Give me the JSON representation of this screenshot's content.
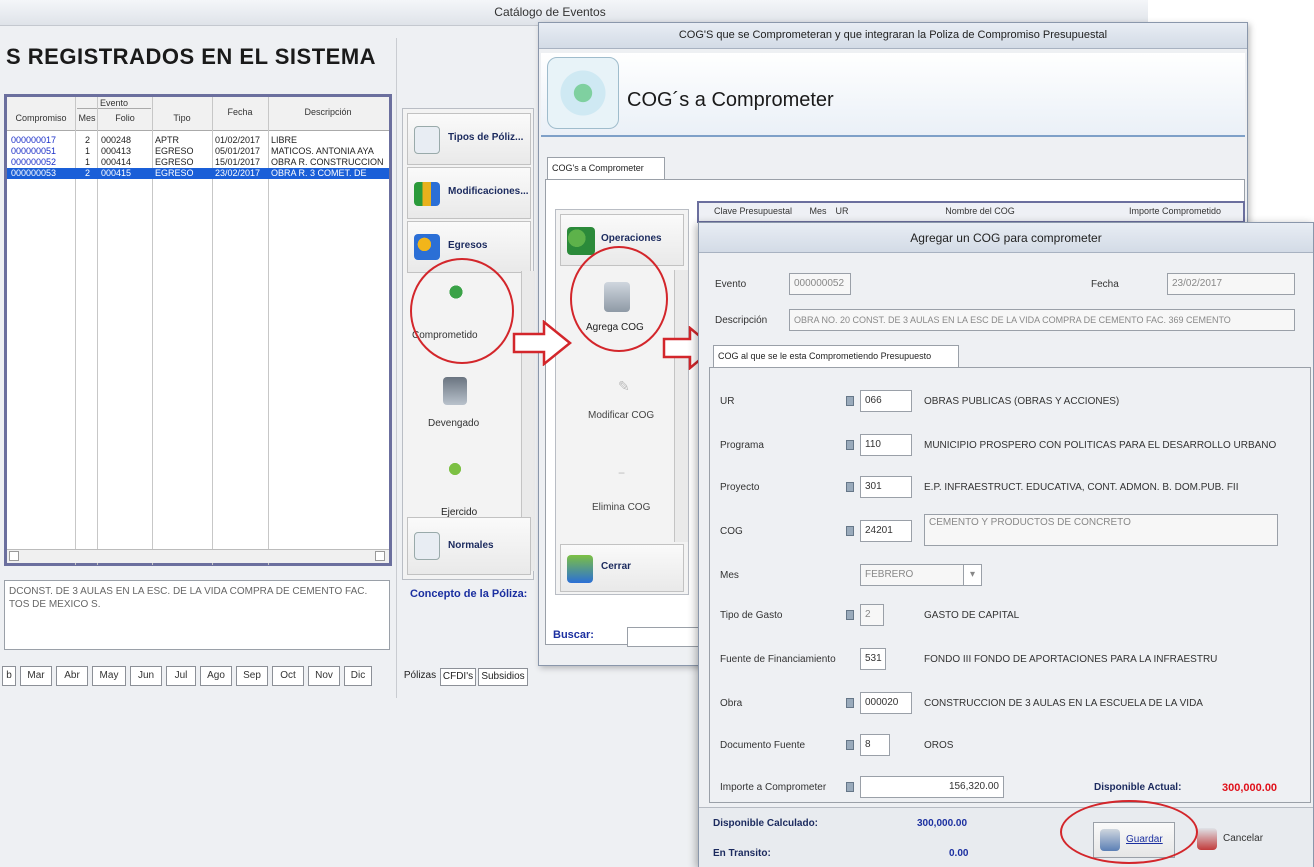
{
  "base_window": {
    "title": "Catálogo de Eventos",
    "heading": "S REGISTRADOS EN EL SISTEMA",
    "grid": {
      "group_header": "Evento",
      "headers": [
        "Compromiso",
        "Mes",
        "Folio",
        "Tipo",
        "Fecha",
        "Descripción"
      ],
      "rows": [
        {
          "compromiso": "000000017",
          "mes": "2",
          "folio": "000248",
          "tipo": "APTR",
          "fecha": "01/02/2017",
          "descripcion": "LIBRE"
        },
        {
          "compromiso": "000000051",
          "mes": "1",
          "folio": "000413",
          "tipo": "EGRESO",
          "fecha": "05/01/2017",
          "descripcion": "MATICOS. ANTONIA AYA"
        },
        {
          "compromiso": "000000052",
          "mes": "1",
          "folio": "000414",
          "tipo": "EGRESO",
          "fecha": "15/01/2017",
          "descripcion": "OBRA R. CONSTRUCCION"
        },
        {
          "compromiso": "000000053",
          "mes": "2",
          "folio": "000415",
          "tipo": "EGRESO",
          "fecha": "23/02/2017",
          "descripcion": "OBRA R. 3 COMET. DE"
        }
      ]
    },
    "concept_text": "DCONST. DE 3 AULAS EN LA ESC. DE LA VIDA COMPRA DE CEMENTO FAC. TOS DE MEXICO S.",
    "month_tabs": [
      "b",
      "Mar",
      "Abr",
      "May",
      "Jun",
      "Jul",
      "Ago",
      "Sep",
      "Oct",
      "Nov",
      "Dic"
    ],
    "side_buttons": {
      "tipos": "Tipos de Póliz...",
      "modificaciones": "Modificaciones...",
      "egresos": "Egresos",
      "comprometido": "Comprometido",
      "devengado": "Devengado",
      "ejercido": "Ejercido",
      "normales": "Normales"
    },
    "concepto_label": "Concepto de la Póliza:",
    "bottom_tabs": [
      "Pólizas",
      "CFDI's",
      "Subsidios"
    ]
  },
  "cog_window": {
    "title": "COG'S que se Comprometeran y que integraran la Poliza de Compromiso Presupuestal",
    "heading": "COG´s a Comprometer",
    "tab": "COG's a Comprometer",
    "buttons": {
      "operaciones": "Operaciones",
      "agregar": "Agrega COG",
      "modificar": "Modificar COG",
      "elimina": "Elimina COG",
      "cerrar": "Cerrar"
    },
    "grid_headers": [
      "Clave Presupuestal",
      "Mes",
      "UR",
      "Nombre del COG",
      "Importe Comprometido"
    ],
    "buscar_label": "Buscar:"
  },
  "add_dialog": {
    "title": "Agregar un COG para comprometer",
    "evento_label": "Evento",
    "evento_value": "000000052",
    "fecha_label": "Fecha",
    "fecha_value": "23/02/2017",
    "descripcion_label": "Descripción",
    "descripcion_value": "OBRA NO. 20 CONST. DE 3 AULAS EN LA ESC DE LA VIDA COMPRA DE CEMENTO FAC. 369 CEMENTO",
    "tab": "COG al que se le esta Comprometiendo Presupuesto",
    "fields": {
      "ur": {
        "label": "UR",
        "code": "066",
        "desc": "OBRAS PUBLICAS (OBRAS Y ACCIONES)"
      },
      "programa": {
        "label": "Programa",
        "code": "110",
        "desc": "MUNICIPIO PROSPERO CON POLITICAS PARA EL DESARROLLO URBANO"
      },
      "proyecto": {
        "label": "Proyecto",
        "code": "301",
        "desc": "E.P. INFRAESTRUCT. EDUCATIVA, CONT. ADMON. B. DOM.PUB. FII"
      },
      "cog": {
        "label": "COG",
        "code": "24201",
        "desc": "CEMENTO Y PRODUCTOS DE CONCRETO"
      },
      "mes": {
        "label": "Mes",
        "value": "FEBRERO"
      },
      "tipo_gasto": {
        "label": "Tipo de Gasto",
        "code": "2",
        "desc": "GASTO DE CAPITAL"
      },
      "fuente": {
        "label": "Fuente de Financiamiento",
        "code": "531",
        "desc": "FONDO III FONDO DE APORTACIONES PARA LA INFRAESTRU"
      },
      "obra": {
        "label": "Obra",
        "code": "000020",
        "desc": "CONSTRUCCION DE 3 AULAS EN LA ESCUELA DE LA VIDA"
      },
      "documento": {
        "label": "Documento Fuente",
        "code": "8",
        "desc": "OROS"
      },
      "importe": {
        "label": "Importe a Comprometer",
        "value": "156,320.00"
      }
    },
    "disponible_actual_label": "Disponible Actual:",
    "disponible_actual_value": "300,000.00",
    "disponible_calc_label": "Disponible Calculado:",
    "disponible_calc_value": "300,000.00",
    "en_transito_label": "En Transito:",
    "en_transito_value": "0.00",
    "guardar": "Guardar",
    "cancelar": "Cancelar"
  },
  "colors": {
    "annotation": "#d3262b",
    "selection": "#1a5fd8",
    "accent_text": "#1b2fa0",
    "disponible": "#e0101a"
  }
}
